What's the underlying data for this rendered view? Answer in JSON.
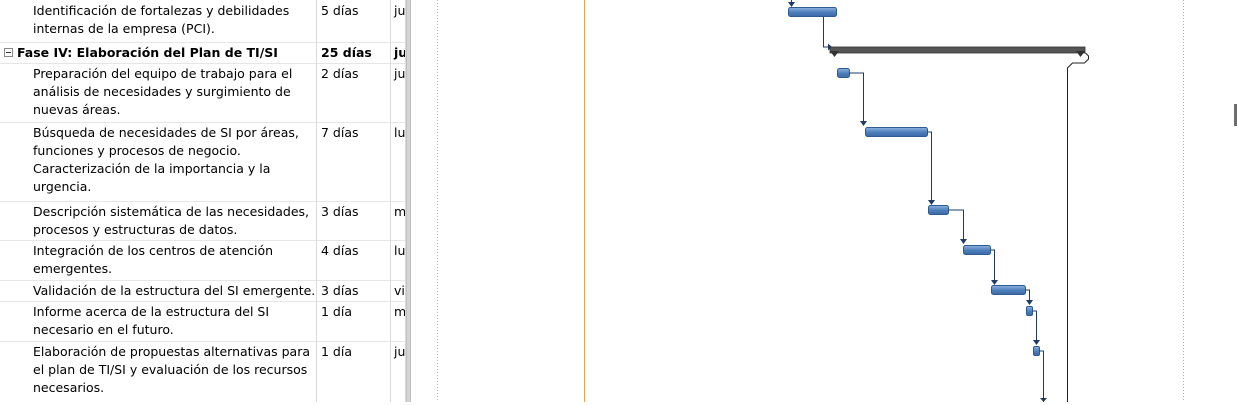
{
  "tasks": [
    {
      "name": "Identificación de fortalezas y debilidades internas de la empresa (PCI).",
      "duration": "5 días",
      "start": "ju",
      "summary": false
    },
    {
      "name": "Fase IV: Elaboración del Plan de TI/SI",
      "duration": "25 días",
      "start": "ju",
      "summary": true
    },
    {
      "name": "Preparación del equipo de trabajo para el análisis de necesidades y surgimiento de nuevas áreas.",
      "duration": "2 días",
      "start": "ju",
      "summary": false
    },
    {
      "name": "Búsqueda de necesidades de SI por áreas, funciones y procesos de negocio. Caracterización de la importancia y la urgencia.",
      "duration": "7 días",
      "start": "lu",
      "summary": false
    },
    {
      "name": "Descripción sistemática de las necesidades, procesos y estructuras de datos.",
      "duration": "3 días",
      "start": "m",
      "summary": false
    },
    {
      "name": "Integración de los centros de atención emergentes.",
      "duration": "4 días",
      "start": "lu",
      "summary": false
    },
    {
      "name": "Validación de la estructura del SI emergente.",
      "duration": "3 días",
      "start": "vi",
      "summary": false
    },
    {
      "name": "Informe acerca de la estructura del SI necesario en el futuro.",
      "duration": "1 día",
      "start": "m",
      "summary": false
    },
    {
      "name": "Elaboración de propuestas alternativas para el plan de TI/SI y evaluación de los recursos necesarios.",
      "duration": "1 día",
      "start": "ju",
      "summary": false
    }
  ],
  "colors": {
    "bar_fill": "#4f81bd",
    "bar_edge": "#2e5b8f",
    "summary_bar": "#555555",
    "link": "#1f3a66",
    "today_line": "#f0a050",
    "gridline": "#b0b0b0"
  }
}
